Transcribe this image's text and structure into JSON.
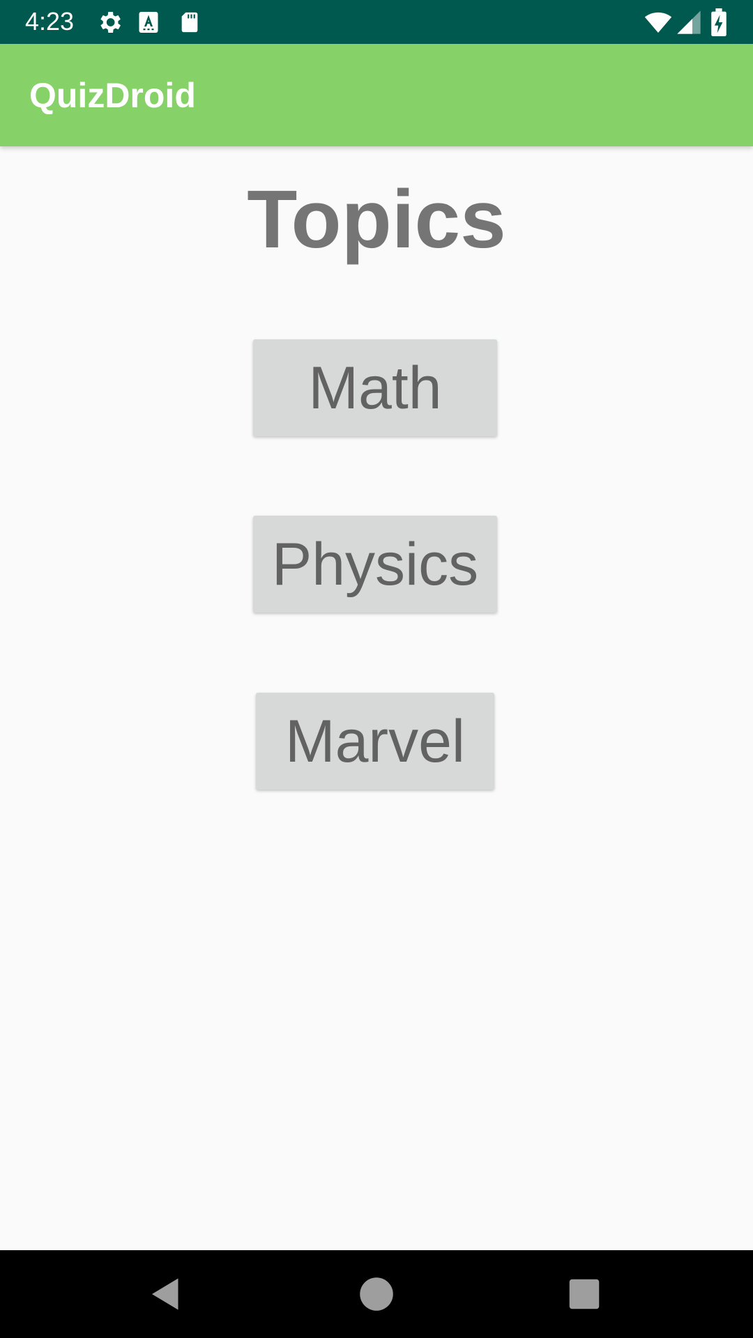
{
  "status_bar": {
    "time": "4:23",
    "icons": [
      "gear-icon",
      "text-a-icon",
      "sd-card-icon",
      "wifi-icon",
      "signal-icon",
      "battery-charging-icon"
    ]
  },
  "app_bar": {
    "title": "QuizDroid",
    "color": "#86d168"
  },
  "main": {
    "heading": "Topics",
    "topics": [
      {
        "label": "Math"
      },
      {
        "label": "Physics"
      },
      {
        "label": "Marvel"
      }
    ]
  },
  "nav_bar": {
    "buttons": [
      "back-icon",
      "home-icon",
      "recents-icon"
    ]
  },
  "colors": {
    "status_bar": "#00594e",
    "app_bar": "#86d168",
    "background": "#fafafa",
    "button_bg": "#d7d8d8",
    "button_text": "#626262",
    "heading_text": "#757575"
  }
}
